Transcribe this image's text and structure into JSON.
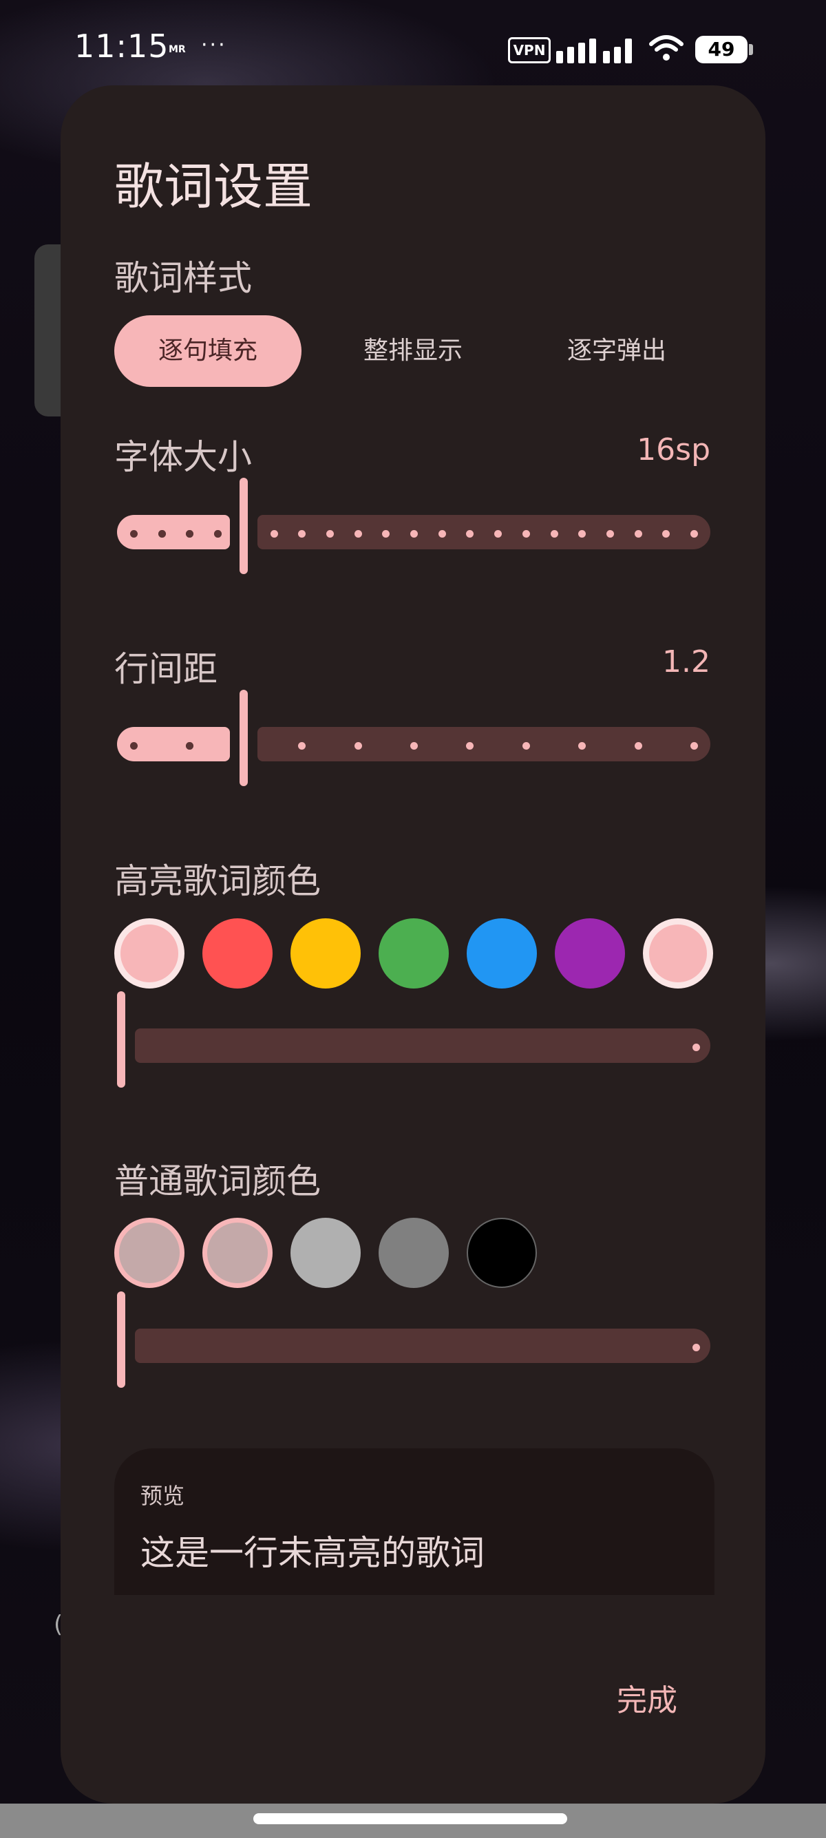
{
  "status_bar": {
    "time": "11:15",
    "carrier_tag": "MR",
    "more": "···",
    "vpn": "VPN",
    "battery": "49"
  },
  "dialog": {
    "title": "歌词设置",
    "style_section": {
      "label": "歌词样式",
      "options": [
        "逐句填充",
        "整排显示",
        "逐字弹出"
      ],
      "selected": "逐句填充"
    },
    "font_size": {
      "label": "字体大小",
      "value": "16sp",
      "steps": 20,
      "current_step": 4
    },
    "line_spacing": {
      "label": "行间距",
      "value": "1.2",
      "steps": 10,
      "current_step": 2
    },
    "highlight_color": {
      "label": "高亮歌词颜色",
      "swatches": [
        "#f7b6b8",
        "#ff5252",
        "#ffc107",
        "#4caf50",
        "#2196f3",
        "#9c27b0",
        "#f7b6b8"
      ],
      "selected_index": 0,
      "slider_value": 0
    },
    "normal_color": {
      "label": "普通歌词颜色",
      "swatches": [
        "#c4a9a9",
        "#c4a9a9",
        "#b0b0b0",
        "#808080",
        "#000000"
      ],
      "selected_index": 0,
      "slider_value": 0
    },
    "preview": {
      "label": "预览",
      "text": "这是一行未高亮的歌词"
    },
    "done_label": "完成"
  },
  "colors": {
    "accent": "#f7b6b8",
    "surface": "#261e1e",
    "track_inactive": "#553535"
  }
}
